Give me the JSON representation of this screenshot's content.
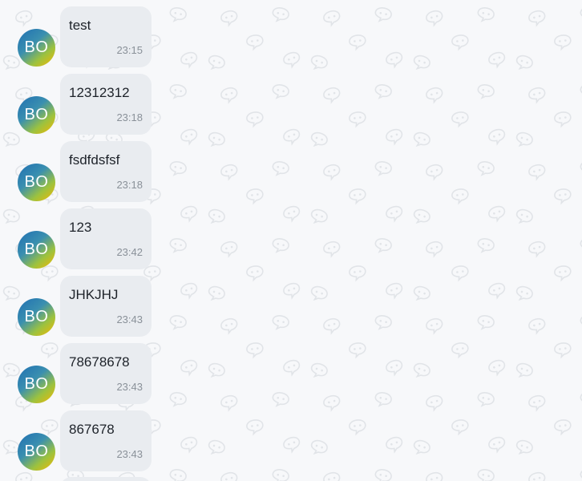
{
  "chat": {
    "avatar_initials": "BO",
    "messages": [
      {
        "text": "test",
        "time": "23:15"
      },
      {
        "text": "12312312",
        "time": "23:18"
      },
      {
        "text": "fsdfdsfsf",
        "time": "23:18"
      },
      {
        "text": "123",
        "time": "23:42"
      },
      {
        "text": "JHKJHJ",
        "time": "23:43"
      },
      {
        "text": "78678678",
        "time": "23:43"
      },
      {
        "text": "867678",
        "time": "23:43"
      }
    ]
  },
  "colors": {
    "background": "#f7f8fa",
    "bubble": "#e9ecf0",
    "text": "#1d2229",
    "time": "#8a9199",
    "pattern_icon": "#e3e6ea"
  },
  "icons": {
    "pattern": "chat-bubble-icon"
  }
}
